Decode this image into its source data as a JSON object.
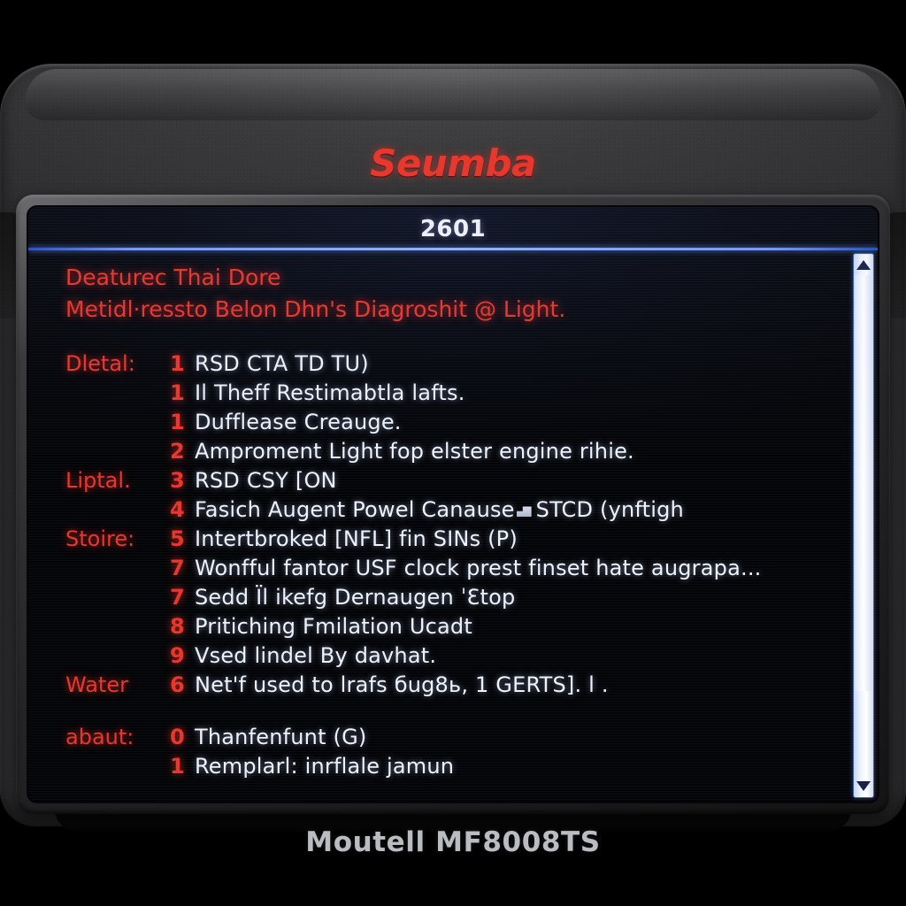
{
  "device": {
    "brand": "Seumba",
    "model": "Moutell MF8008TS"
  },
  "screen": {
    "header_title": "2601",
    "header_lines": [
      "Deaturec Thai Dore",
      "Metidl·ressto Belon Dhn's Diagroshit @ Light."
    ],
    "rows": [
      {
        "label": "Dletal:",
        "num": "1",
        "text": "RSD CTA TD TU)"
      },
      {
        "label": "",
        "num": "1",
        "text": "Il Theff Restimabtla lafts."
      },
      {
        "label": "",
        "num": "1",
        "text": "Dufflease Creauge."
      },
      {
        "label": "",
        "num": "2",
        "text": "Amproment Light fop elster engine rihie."
      },
      {
        "label": "Liptal.",
        "num": "3",
        "text": "RSD CSY [ON"
      },
      {
        "label": "",
        "num": "4",
        "text_before": "Fasich Augent Powel Canause",
        "glyph": "block-glyph",
        "text_after": "STCD (уnftigh"
      },
      {
        "label": "Stoire:",
        "num": "5",
        "text": "Intertbroked [NFL] fin SINs (P)"
      },
      {
        "label": "",
        "num": "7",
        "text": "Wonfful fantor USF clock prest finset hate augrapа..."
      },
      {
        "label": "",
        "num": "7",
        "text": "Sedd Ïl ikefg Dernaugen ˈƐtop"
      },
      {
        "label": "",
        "num": "8",
        "text": "Pritiching Fmilation Ucadt"
      },
      {
        "label": "",
        "num": "9",
        "text": "Vsed lindel By davhat."
      },
      {
        "label": "Water",
        "num": "6",
        "text": "Net'f used to lrafs бug8ь, 1 GERTS]. l ."
      },
      {
        "label": "abaut:",
        "num": "0",
        "text": "Thanfenfunt (G)"
      },
      {
        "label": "",
        "num": "1",
        "text": "Remplarl: inrflale jamun"
      }
    ],
    "scrollbar": {
      "up_arrow": "triangle-up-icon",
      "down_arrow": "triangle-down-icon"
    }
  },
  "colors": {
    "accent_red": "#e8352c",
    "text_white": "#eef2fb",
    "rule_blue": "#8fb4ff",
    "screen_bg": "#06080f",
    "housing": "#35353 7"
  }
}
